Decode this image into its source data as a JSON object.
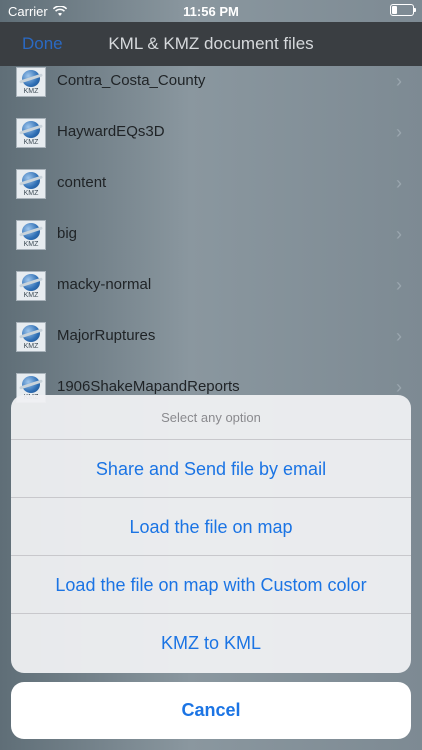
{
  "status_bar": {
    "carrier": "Carrier",
    "time": "11:56 PM"
  },
  "navbar": {
    "done_label": "Done",
    "title": "KML & KMZ document files"
  },
  "file_icon_tag": "KMZ",
  "files": [
    {
      "name": "Contra_Costa_County"
    },
    {
      "name": "HaywardEQs3D"
    },
    {
      "name": "content"
    },
    {
      "name": "big"
    },
    {
      "name": "macky-normal"
    },
    {
      "name": "MajorRuptures"
    },
    {
      "name": "1906ShakeMapandReports"
    }
  ],
  "action_sheet": {
    "title": "Select any option",
    "options": [
      {
        "label": "Share and Send file by email"
      },
      {
        "label": "Load the file on map"
      },
      {
        "label": "Load the file on map with Custom color"
      },
      {
        "label": "KMZ to KML"
      }
    ],
    "cancel_label": "Cancel"
  },
  "colors": {
    "action_text": "#1b74e4",
    "navbar_bg": "#3a3e42",
    "sheet_title_text": "#8a8a8e"
  }
}
